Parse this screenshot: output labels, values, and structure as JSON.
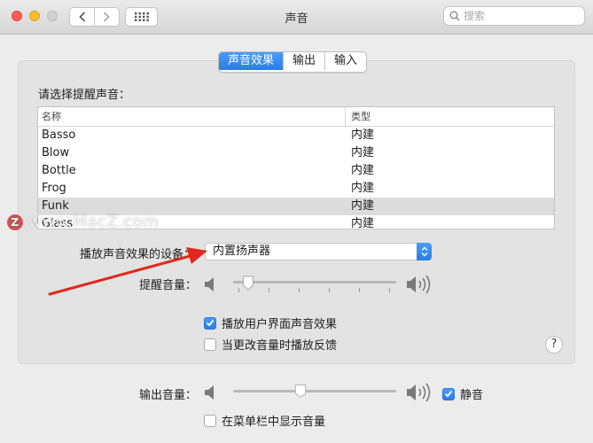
{
  "window": {
    "title": "声音"
  },
  "toolbar": {
    "search_placeholder": "搜索"
  },
  "tabs": [
    {
      "label": "声音效果",
      "active": true
    },
    {
      "label": "输出",
      "active": false
    },
    {
      "label": "输入",
      "active": false
    }
  ],
  "alert": {
    "prompt": "请选择提醒声音：",
    "columns": {
      "name": "名称",
      "type": "类型"
    },
    "sounds": [
      {
        "name": "Basso",
        "type": "内建"
      },
      {
        "name": "Blow",
        "type": "内建"
      },
      {
        "name": "Bottle",
        "type": "内建"
      },
      {
        "name": "Frog",
        "type": "内建"
      },
      {
        "name": "Funk",
        "type": "内建",
        "selected": true
      },
      {
        "name": "Glass",
        "type": "内建"
      }
    ]
  },
  "watermark": {
    "text": "www.MacZ.com",
    "logo_letter": "Z"
  },
  "effects": {
    "device_label": "播放声音效果的设备：",
    "device_value": "内置扬声器",
    "alert_volume_label": "提醒音量：",
    "alert_volume_level": 0.06,
    "ui_sounds_label": "播放用户界面声音效果",
    "ui_sounds_checked": true,
    "volume_feedback_label": "当更改音量时播放反馈",
    "volume_feedback_checked": false
  },
  "output": {
    "volume_label": "输出音量：",
    "volume_level": 0.41,
    "mute_label": "静音",
    "mute_checked": true,
    "menubar_label": "在菜单栏中显示音量",
    "menubar_checked": false
  },
  "help": {
    "label": "?"
  },
  "colors": {
    "accent": "#2f80ed",
    "annotation_arrow": "#e0281e"
  }
}
